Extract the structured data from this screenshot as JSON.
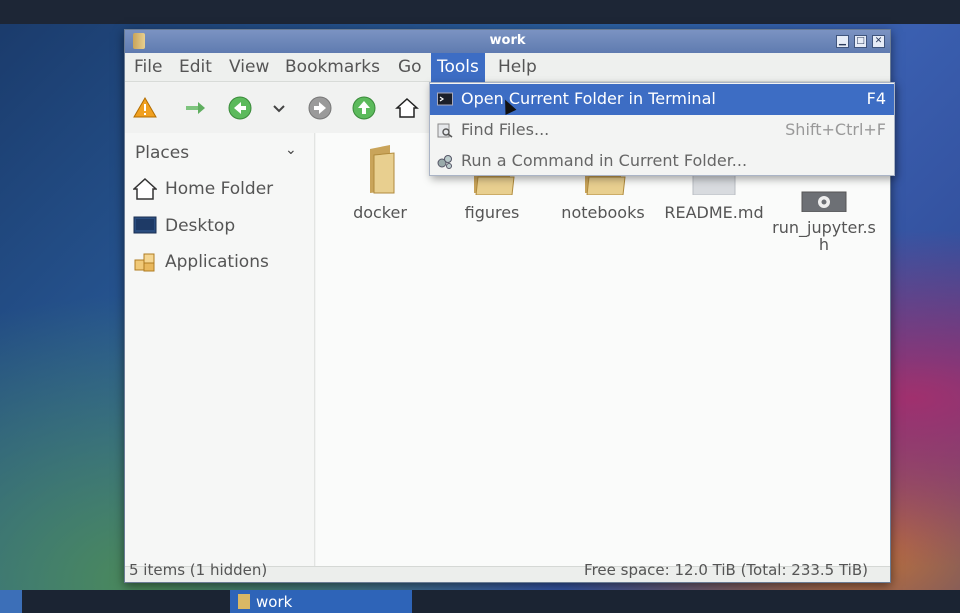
{
  "window": {
    "title": "work"
  },
  "menubar": [
    "File",
    "Edit",
    "View",
    "Bookmarks",
    "Go",
    "Tools",
    "Help"
  ],
  "toolbar_icons": [
    "warning-icon",
    "forward-arrow-icon",
    "back-icon",
    "history-dropdown-icon",
    "forward-icon",
    "up-icon",
    "home-icon"
  ],
  "sidebar": {
    "header": "Places",
    "items": [
      {
        "label": "Home Folder",
        "icon": "home-icon"
      },
      {
        "label": "Desktop",
        "icon": "desktop-icon"
      },
      {
        "label": "Applications",
        "icon": "applications-icon"
      }
    ]
  },
  "files": [
    {
      "name": "docker",
      "icon": "folder-icon"
    },
    {
      "name": "figures",
      "icon": "folder-icon"
    },
    {
      "name": "notebooks",
      "icon": "folder-icon"
    },
    {
      "name": "README.md",
      "icon": "text-file-icon"
    },
    {
      "name": "run_jupyter.s\nh",
      "icon": "script-file-icon"
    }
  ],
  "tools_menu": [
    {
      "label": "Open Current Folder in Terminal",
      "shortcut": "F4",
      "icon": "terminal-icon"
    },
    {
      "label": "Find Files...",
      "shortcut": "Shift+Ctrl+F",
      "icon": "search-icon"
    },
    {
      "label": "Run a Command in Current Folder...",
      "shortcut": "",
      "icon": "gears-icon"
    }
  ],
  "status": {
    "left": "5 items (1 hidden)",
    "right": "Free space: 12.0 TiB (Total: 233.5 TiB)"
  },
  "taskbar": {
    "task_label": "work"
  },
  "colors": {
    "accent": "#3d6dc4",
    "titlebar": "#6b86ba"
  }
}
